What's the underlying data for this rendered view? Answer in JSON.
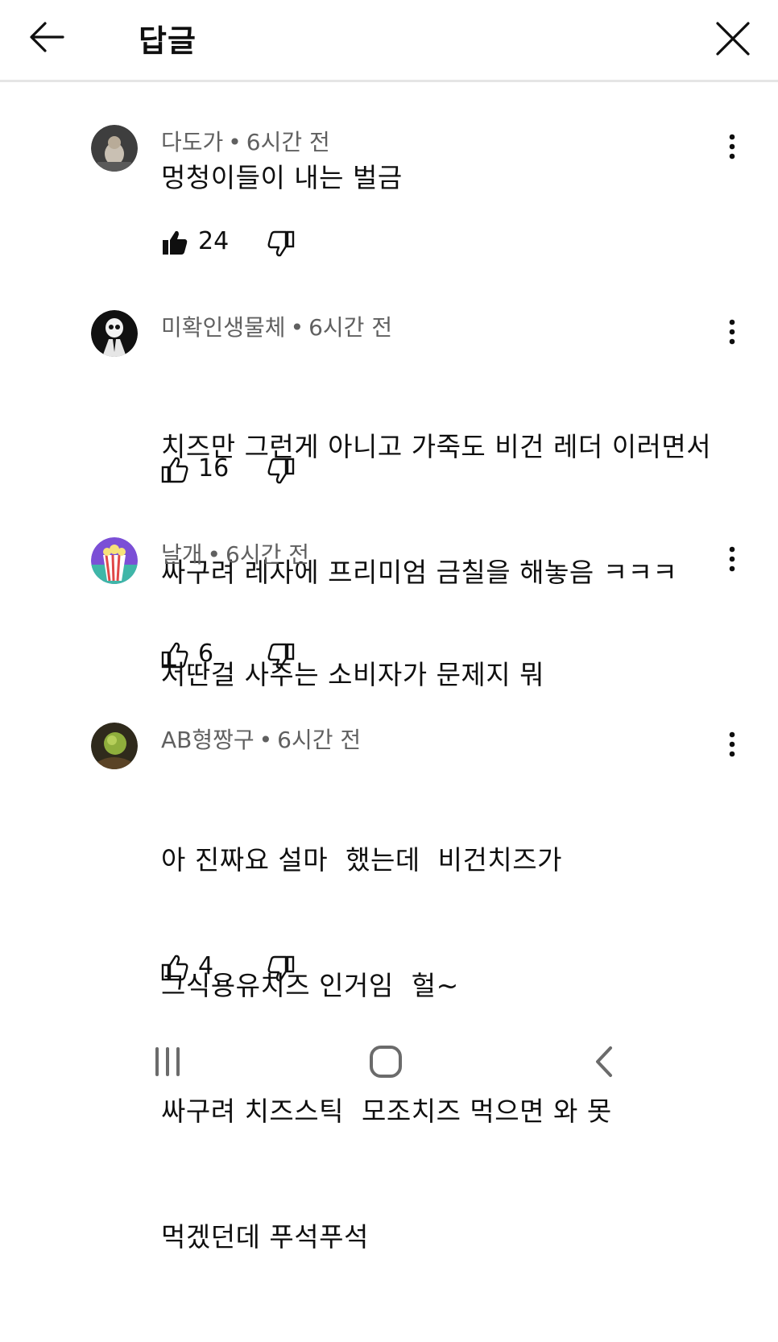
{
  "header": {
    "title": "답글",
    "back_icon": "arrow-left-icon",
    "close_icon": "close-icon"
  },
  "comments": [
    {
      "author": "다도가",
      "separator": "•",
      "time": "6시간 전",
      "lines": [
        "멍청이들이 내는 벌금"
      ],
      "likes": "24",
      "liked": true,
      "avatar_color": "#6b6b6b"
    },
    {
      "author": "미확인생물체",
      "separator": "•",
      "time": "6시간 전",
      "lines": [
        "치즈만 그런게 아니고 가죽도 비건 레더 이러면서",
        "싸구려 레자에 프리미엄 금칠을 해놓음 ㅋㅋㅋ"
      ],
      "likes": "16",
      "liked": false,
      "avatar_color": "#111111"
    },
    {
      "author": "날개",
      "separator": "•",
      "time": "6시간 전",
      "lines": [
        "저딴걸 사주는 소비자가 문제지 뭐"
      ],
      "likes": "6",
      "liked": false,
      "avatar_color": "#7b4fd6"
    },
    {
      "author": "AB형짱구",
      "separator": "•",
      "time": "6시간 전",
      "lines": [
        "아 진짜요 설마  했는데  비건치즈가",
        "그식용유치즈 인거임  헐~",
        "싸구려 치즈스틱  모조치즈 먹으면 와 못",
        "먹겠던데 푸석푸석"
      ],
      "likes": "4",
      "liked": false,
      "avatar_color": "#4a5a2a"
    }
  ],
  "navbar": {
    "recent_icon": "recent-apps-icon",
    "home_icon": "home-icon",
    "back_icon": "nav-back-icon"
  }
}
